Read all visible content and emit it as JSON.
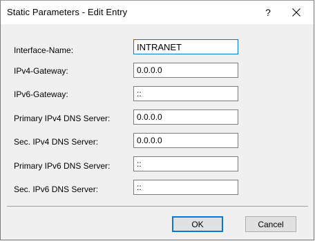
{
  "window": {
    "title": "Static Parameters - Edit Entry",
    "help_glyph": "?",
    "close_icon": "close-icon"
  },
  "form": {
    "fields": [
      {
        "label": "Interface-Name:",
        "value": "INTRANET"
      },
      {
        "label": "IPv4-Gateway:",
        "value": "0.0.0.0"
      },
      {
        "label": "IPv6-Gateway:",
        "value": "::"
      },
      {
        "label": "Primary IPv4 DNS Server:",
        "value": "0.0.0.0"
      },
      {
        "label": "Sec. IPv4 DNS Server:",
        "value": "0.0.0.0"
      },
      {
        "label": "Primary IPv6 DNS Server:",
        "value": "::"
      },
      {
        "label": "Sec. IPv6 DNS Server:",
        "value": "::"
      }
    ]
  },
  "buttons": {
    "ok_label": "OK",
    "cancel_label": "Cancel"
  },
  "colors": {
    "focus_accent": "#0078d7",
    "dialog_bg": "#f0f0f0",
    "titlebar_bg": "#ffffff"
  }
}
